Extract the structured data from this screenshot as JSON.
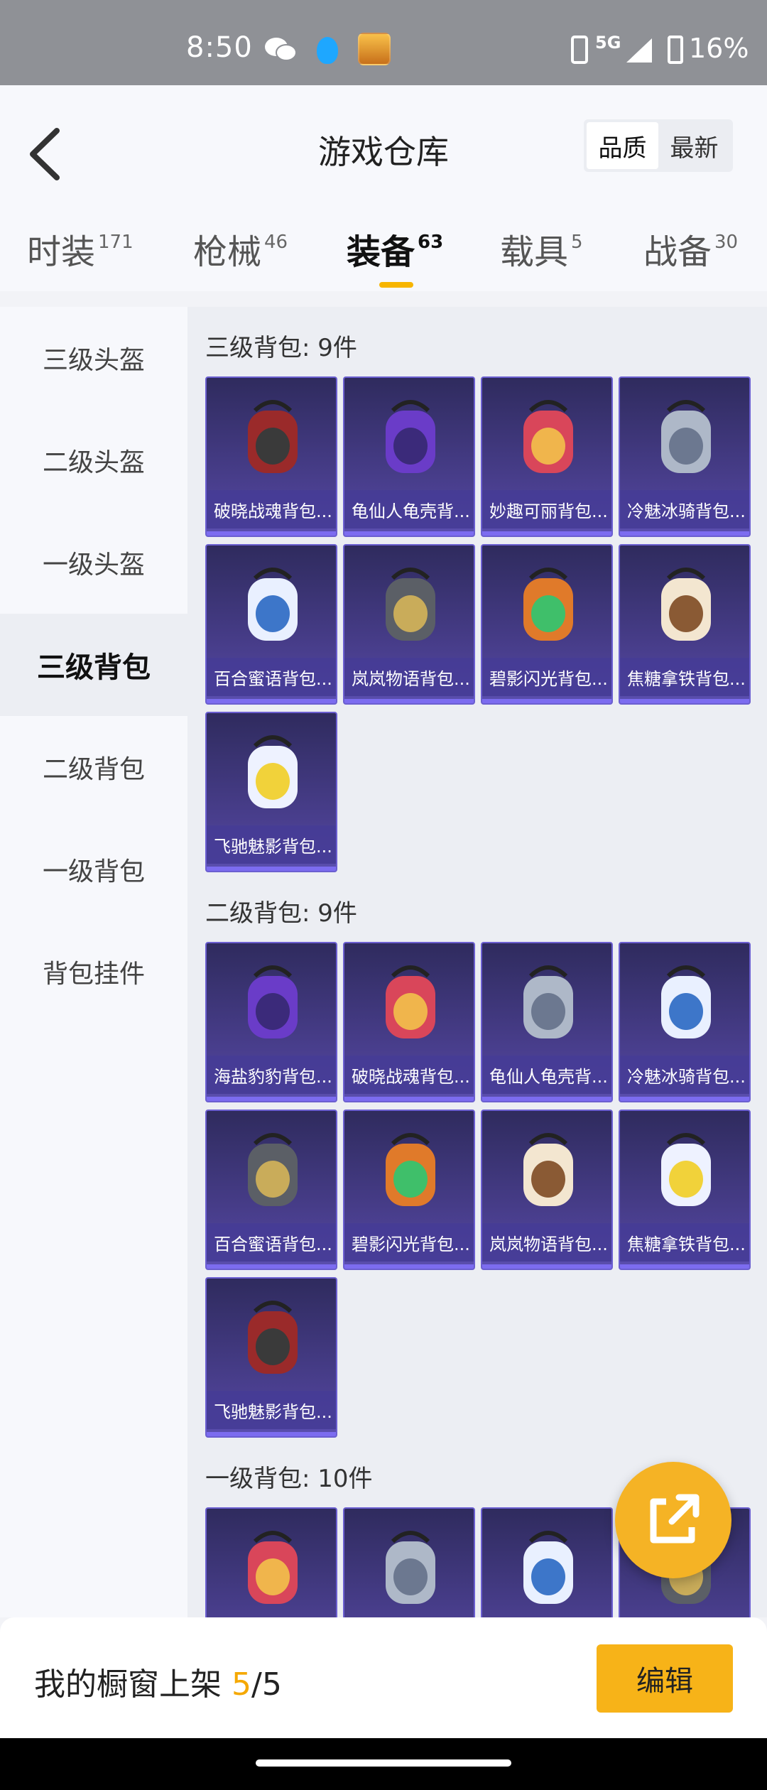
{
  "status_bar": {
    "time": "8:50",
    "network": "5G",
    "battery": "16%"
  },
  "header": {
    "title": "游戏仓库",
    "sort_options": [
      {
        "label": "品质",
        "active": true
      },
      {
        "label": "最新",
        "active": false
      }
    ]
  },
  "tabs": [
    {
      "label": "时装",
      "count": "171"
    },
    {
      "label": "枪械",
      "count": "46"
    },
    {
      "label": "装备",
      "count": "63",
      "active": true
    },
    {
      "label": "载具",
      "count": "5"
    },
    {
      "label": "战备",
      "count": "30"
    }
  ],
  "sidebar": {
    "items": [
      {
        "label": "三级头盔"
      },
      {
        "label": "二级头盔"
      },
      {
        "label": "一级头盔"
      },
      {
        "label": "三级背包",
        "active": true
      },
      {
        "label": "二级背包"
      },
      {
        "label": "一级背包"
      },
      {
        "label": "背包挂件"
      }
    ]
  },
  "sections": [
    {
      "title": "三级背包: 9件",
      "items": [
        "破晓战魂背包...",
        "龟仙人龟壳背...",
        "妙趣可丽背包...",
        "冷魅冰骑背包...",
        "百合蜜语背包...",
        "岚岚物语背包...",
        "碧影闪光背包...",
        "焦糖拿铁背包...",
        "飞驰魅影背包..."
      ]
    },
    {
      "title": "二级背包: 9件",
      "items": [
        "海盐豹豹背包...",
        "破晓战魂背包...",
        "龟仙人龟壳背...",
        "冷魅冰骑背包...",
        "百合蜜语背包...",
        "碧影闪光背包...",
        "岚岚物语背包...",
        "焦糖拿铁背包...",
        "飞驰魅影背包..."
      ]
    },
    {
      "title": "一级背包: 10件",
      "items": [
        "",
        "",
        "",
        ""
      ]
    }
  ],
  "bottom_bar": {
    "label": "我的橱窗上架",
    "count": "5",
    "total": "/5",
    "edit_label": "编辑"
  },
  "colors": {
    "accent": "#f7b318",
    "card_bg": "#3f3680",
    "card_border": "#6b5fd0"
  },
  "icons": {
    "back": "chevron-left-icon",
    "fab": "share-external-icon"
  }
}
